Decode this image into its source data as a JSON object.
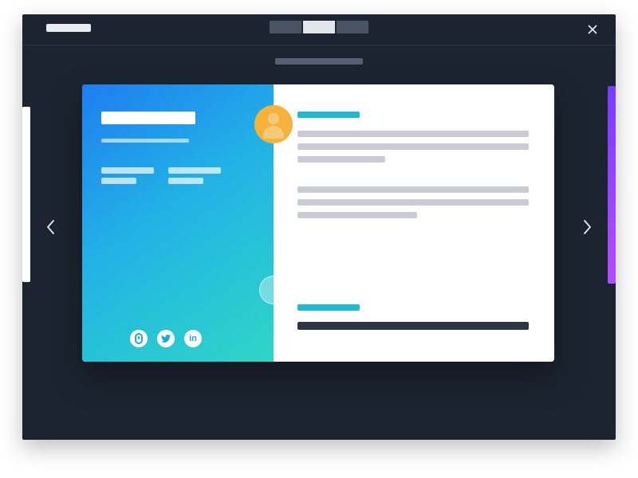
{
  "colors": {
    "bg": "#1b2430",
    "accent": "#1fb9d1",
    "avatar": "#f6b23a",
    "gradient_from": "#1e7ef0",
    "gradient_mid": "#22b2e6",
    "gradient_to": "#2fd6c6",
    "peek_right_from": "#7a3cff",
    "peek_right_to": "#b34dff"
  },
  "topbar": {
    "brand": "",
    "tabs": [
      {
        "label": "",
        "active": false
      },
      {
        "label": "",
        "active": true
      },
      {
        "label": "",
        "active": false
      }
    ],
    "close_label": "Close",
    "subtitle": ""
  },
  "nav": {
    "prev_label": "Previous",
    "next_label": "Next"
  },
  "card": {
    "profile": {
      "name": "",
      "tagline": "",
      "field_a_label": "",
      "field_a_value": "",
      "field_b_label": "",
      "field_b_value": "",
      "avatar_alt": "avatar",
      "socials": [
        {
          "name": "website",
          "glyph": ""
        },
        {
          "name": "twitter",
          "glyph": ""
        },
        {
          "name": "linkedin",
          "glyph": "in"
        }
      ]
    },
    "sections": [
      {
        "title": "",
        "lines": [
          "",
          "",
          "",
          "",
          "",
          ""
        ]
      },
      {
        "title": "",
        "bar": ""
      }
    ]
  }
}
